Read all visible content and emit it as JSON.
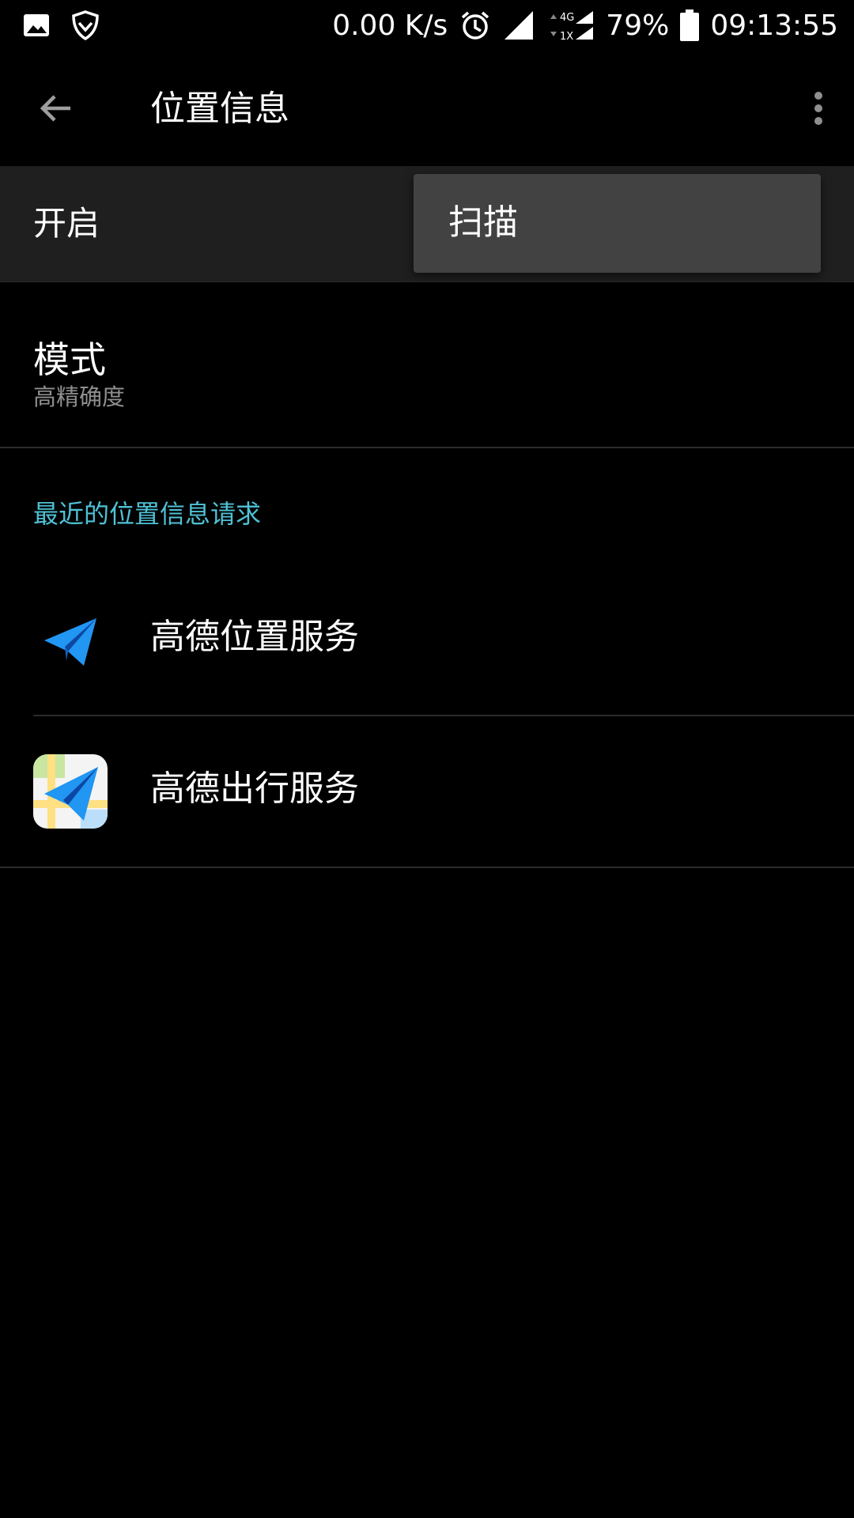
{
  "status_bar": {
    "net_speed": "0.00 K/s",
    "network_small_top": "4G",
    "network_small_bottom": "1X",
    "battery": "79%",
    "time": "09:13:55",
    "icons": [
      "image-icon",
      "shield-icon",
      "alarm-icon",
      "signal-icon",
      "signal-4g-icon",
      "battery-icon"
    ]
  },
  "app_bar": {
    "title": "位置信息",
    "back_icon": "arrow-back-icon",
    "menu_icon": "more-vert-icon"
  },
  "location_toggle": {
    "label": "开启"
  },
  "popup_menu": {
    "items": [
      "扫描"
    ]
  },
  "mode": {
    "title": "模式",
    "value": "高精确度"
  },
  "recent_requests": {
    "header": "最近的位置信息请求",
    "apps": [
      {
        "name": "高德位置服务",
        "icon": "paper-plane-icon"
      },
      {
        "name": "高德出行服务",
        "icon": "amap-icon"
      }
    ]
  },
  "colors": {
    "accent": "#4fc2d6",
    "background": "#000000",
    "toggle_row_bg": "#1f1f1f",
    "popup_bg": "#424242"
  }
}
